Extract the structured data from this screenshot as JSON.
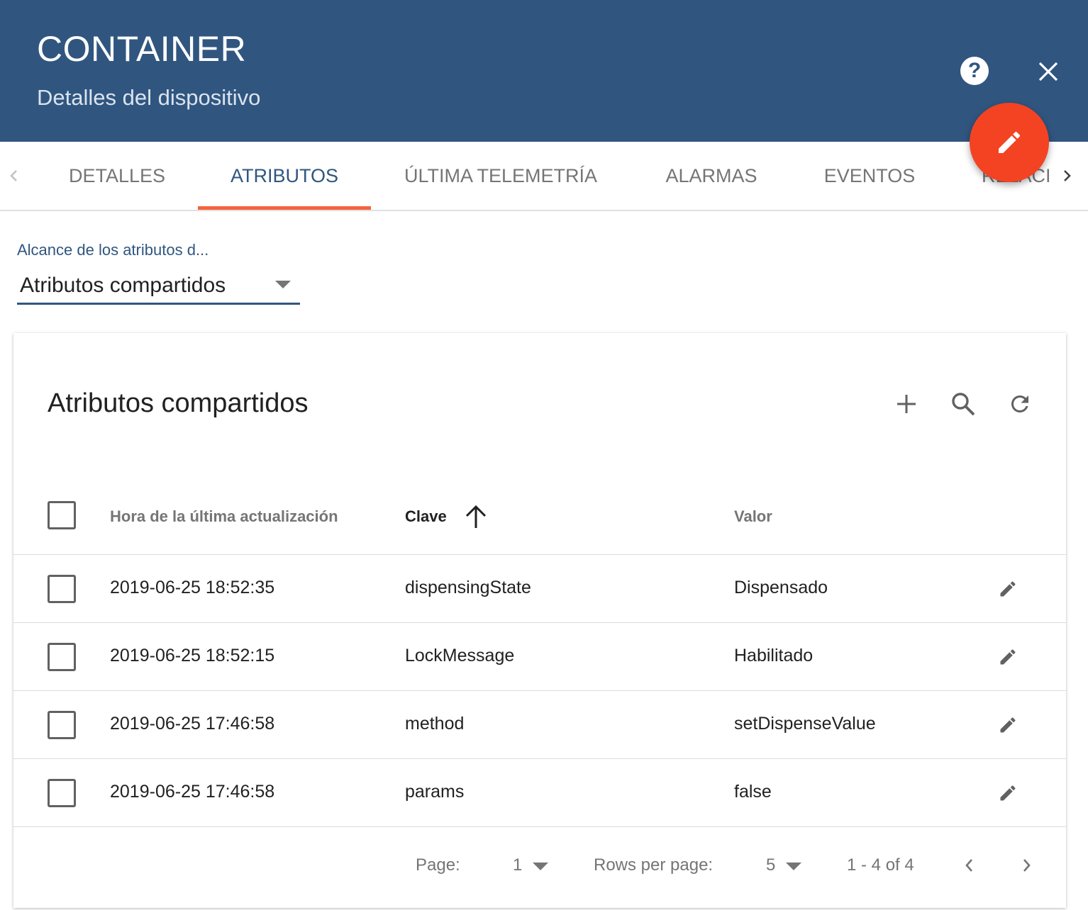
{
  "header": {
    "title": "CONTAINER",
    "subtitle": "Detalles del dispositivo",
    "background_color": "#305680",
    "help_icon": "help-circle-icon",
    "close_icon": "close-icon",
    "fab_icon": "pencil-icon",
    "fab_color": "#f44323"
  },
  "tabs": {
    "items": [
      {
        "label": "DETALLES",
        "active": false
      },
      {
        "label": "ATRIBUTOS",
        "active": true
      },
      {
        "label": "ÚLTIMA TELEMETRÍA",
        "active": false
      },
      {
        "label": "ALARMAS",
        "active": false
      },
      {
        "label": "EVENTOS",
        "active": false
      },
      {
        "label": "RELACI",
        "active": false
      }
    ],
    "active_color": "#305680",
    "ink_color": "#f4633e"
  },
  "scope": {
    "label": "Alcance de los atributos d...",
    "value": "Atributos compartidos"
  },
  "card": {
    "title": "Atributos compartidos",
    "toolbar_icons": [
      "add-icon",
      "search-icon",
      "refresh-icon"
    ]
  },
  "table": {
    "columns": [
      {
        "label": "Hora de la última actualización"
      },
      {
        "label": "Clave",
        "sort": "ascending"
      },
      {
        "label": "Valor"
      }
    ],
    "rows": [
      {
        "time": "2019-06-25 18:52:35",
        "key": "dispensingState",
        "value": "Dispensado"
      },
      {
        "time": "2019-06-25 18:52:15",
        "key": "LockMessage",
        "value": "Habilitado"
      },
      {
        "time": "2019-06-25 17:46:58",
        "key": "method",
        "value": "setDispenseValue"
      },
      {
        "time": "2019-06-25 17:46:58",
        "key": "params",
        "value": "false"
      }
    ]
  },
  "pagination": {
    "page_label": "Page:",
    "page_value": "1",
    "rows_label": "Rows per page:",
    "rows_value": "5",
    "range": "1 - 4 of 4"
  }
}
